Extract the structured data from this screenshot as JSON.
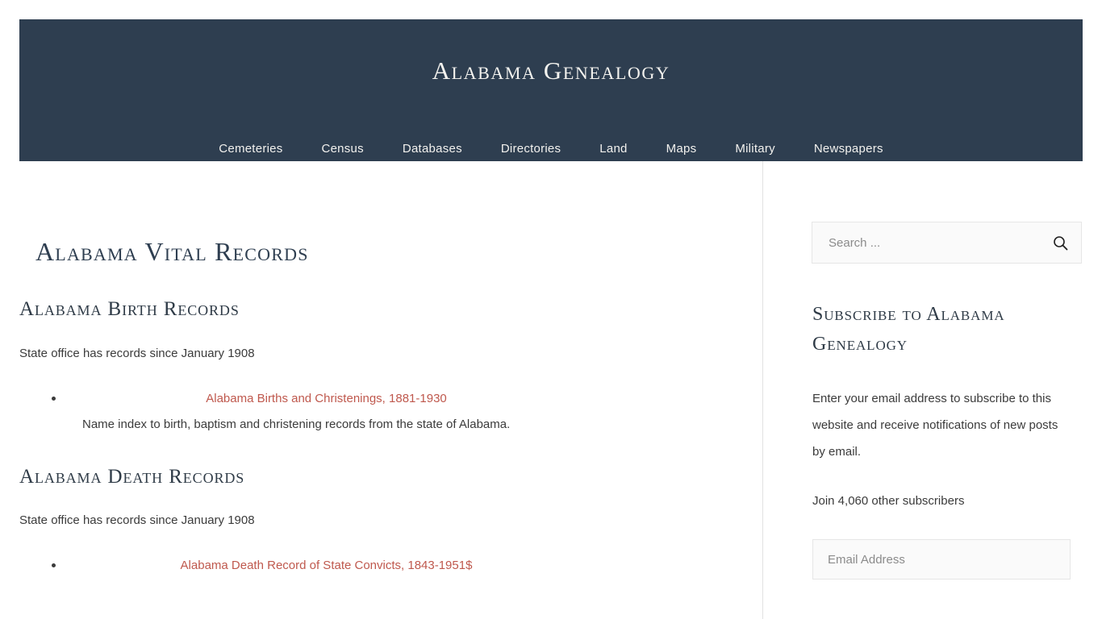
{
  "header": {
    "site_title": "Alabama Genealogy",
    "background_color": "#2e3e50",
    "nav": [
      {
        "label": "Cemeteries"
      },
      {
        "label": "Census"
      },
      {
        "label": "Databases"
      },
      {
        "label": "Directories"
      },
      {
        "label": "Land"
      },
      {
        "label": "Maps"
      },
      {
        "label": "Military"
      },
      {
        "label": "Newspapers"
      }
    ]
  },
  "main": {
    "page_title": "Alabama Vital Records",
    "link_color": "#bf584d",
    "sections": [
      {
        "heading": "Alabama Birth Records",
        "intro": "State office has records since January 1908",
        "items": [
          {
            "link": "Alabama Births and Christenings, 1881-1930",
            "cost": "",
            "description": "Name index to birth, baptism and christening records from the state of Alabama."
          }
        ]
      },
      {
        "heading": "Alabama Death Records",
        "intro": "State office has records since January 1908",
        "items": [
          {
            "link": "Alabama Death Record of State Convicts, 1843-1951",
            "cost": "$",
            "description": ""
          }
        ]
      }
    ]
  },
  "sidebar": {
    "search": {
      "placeholder": "Search ...",
      "value": "",
      "icon": "search-icon"
    },
    "subscribe": {
      "title": "Subscribe to Alabama Genealogy",
      "description": "Enter your email address to subscribe to this website and receive notifications of new posts by email.",
      "subscriber_count": "Join 4,060 other subscribers",
      "email_placeholder": "Email Address",
      "email_value": ""
    }
  }
}
